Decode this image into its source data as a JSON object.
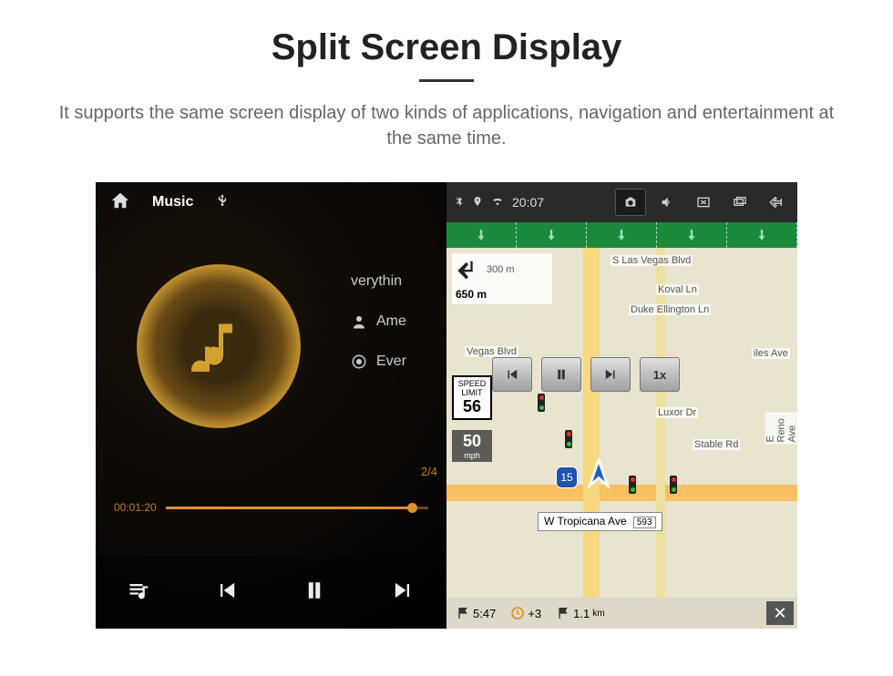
{
  "header": {
    "title": "Split Screen Display",
    "description": "It supports the same screen display of two kinds of applications, navigation and entertainment at the same time."
  },
  "music": {
    "topbar": {
      "title": "Music",
      "usb_label": "USB"
    },
    "tracks": {
      "row1": "verythin",
      "row2": "Ame",
      "row3": "Ever"
    },
    "index": "2/4",
    "time_elapsed": "00:01:20"
  },
  "statusbar": {
    "time": "20:07"
  },
  "nav": {
    "turn": {
      "dist1": "300 m",
      "dist2": "650 m"
    },
    "speed_limit": {
      "label1": "SPEED",
      "label2": "LIMIT",
      "value": "56"
    },
    "current_speed": {
      "value": "50",
      "unit": "mph"
    },
    "interstate": "15",
    "streets": {
      "s_las_vegas": "S Las Vegas Blvd",
      "koval": "Koval Ln",
      "duke": "Duke Ellington Ln",
      "luxor": "Luxor Dr",
      "stable": "Stable Rd",
      "reno": "E Reno Ave",
      "tropicana": "W Tropicana Ave",
      "tropicana_badge": "593",
      "vegas_blvd2": "Vegas Blvd",
      "iles": "iles Ave"
    },
    "overlay": {
      "speed_btn": "1x"
    },
    "bottom": {
      "eta": "5:47",
      "extra": "+3",
      "distance": "1.1",
      "dist_unit": "km"
    }
  }
}
